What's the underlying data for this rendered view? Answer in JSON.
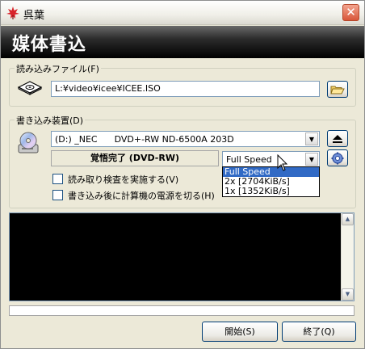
{
  "window": {
    "title": "呉葉",
    "close_symbol": "✕"
  },
  "banner": {
    "title": "媒体書込"
  },
  "read_file": {
    "group_label": "読み込みファイル(F)",
    "path": "L:¥video¥icee¥ICEE.ISO",
    "browse_icon": "folder-icon"
  },
  "writer": {
    "group_label": "書き込み装置(D)",
    "device": "(D:) _NEC      DVD+-RW ND-6500A 203D",
    "status": "覚悟完了 (DVD-RW)",
    "speed_selected": "Full Speed",
    "speed_options": [
      "Full Speed",
      "2x [2704KiB/s]",
      "1x [1352KiB/s]"
    ],
    "eject_icon": "eject-icon",
    "settings_icon": "gear-icon"
  },
  "options": {
    "verify_label": "読み取り検査を実施する(V)",
    "shutdown_label": "書き込み後に計算機の電源を切る(H)",
    "verify_checked": false,
    "shutdown_checked": false
  },
  "buttons": {
    "start": "開始(S)",
    "exit": "終了(Q)"
  },
  "progress": {
    "value": 0
  }
}
